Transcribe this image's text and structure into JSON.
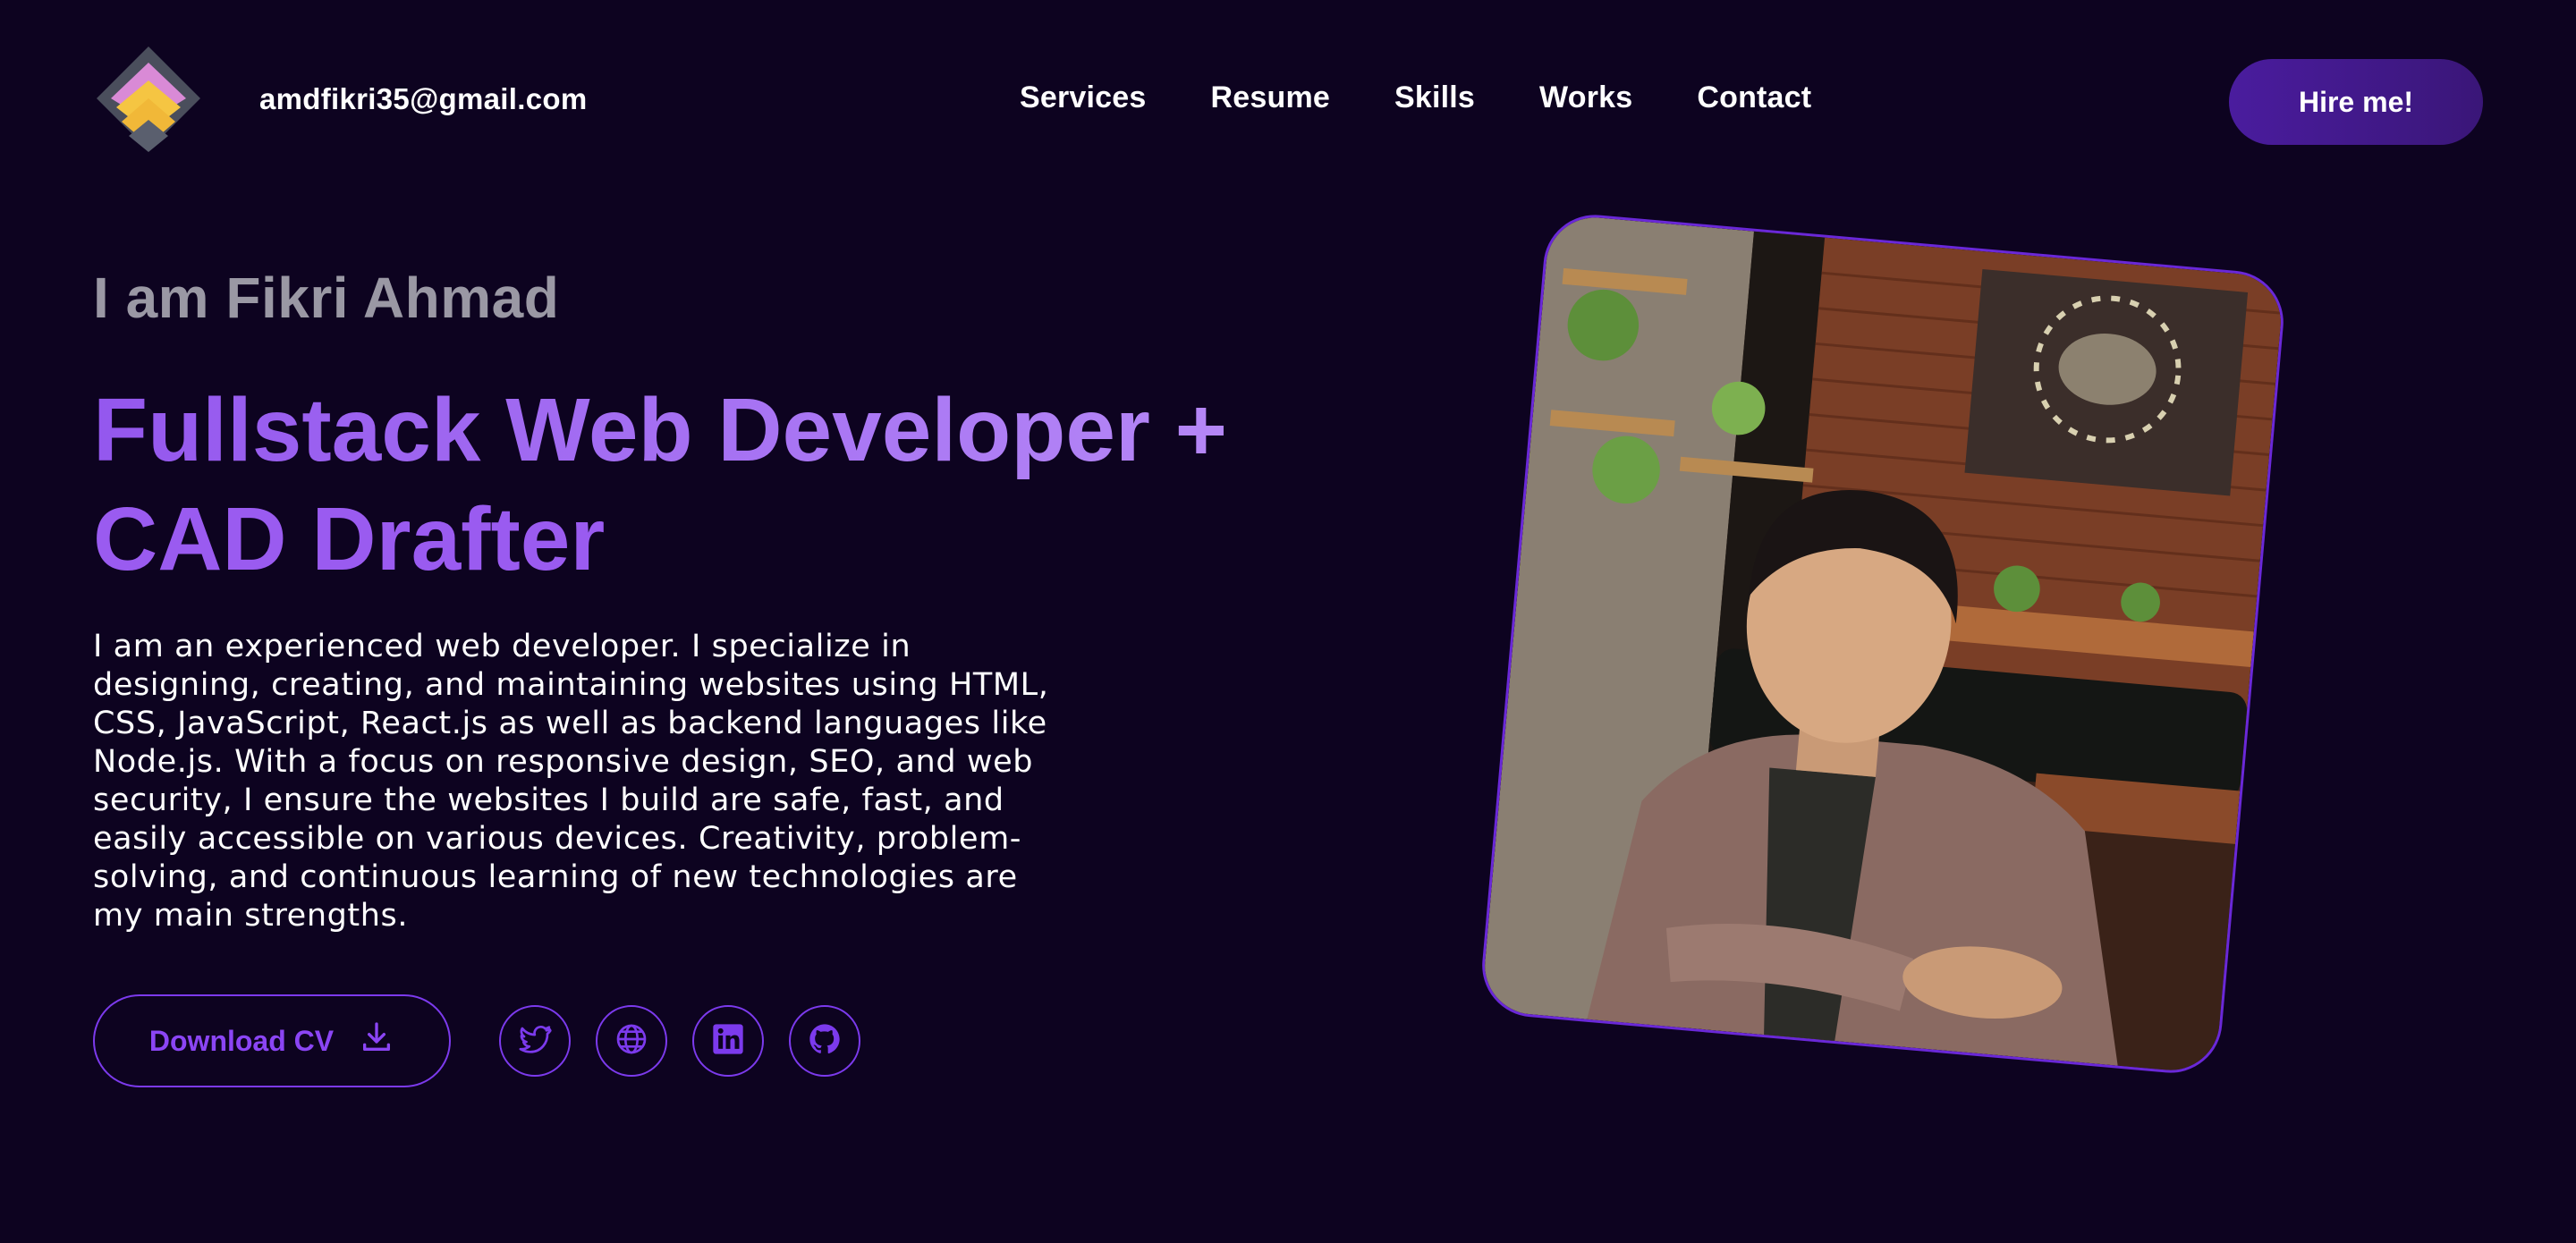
{
  "header": {
    "email": "amdfikri35@gmail.com",
    "nav": [
      {
        "label": "Services"
      },
      {
        "label": "Resume"
      },
      {
        "label": "Skills"
      },
      {
        "label": "Works"
      },
      {
        "label": "Contact"
      }
    ],
    "hire_label": "Hire me!",
    "logo_icon": "diamond-logo-icon"
  },
  "hero": {
    "intro": "I am Fikri Ahmad",
    "headline_line1": "Fullstack Web Developer +",
    "headline_line2": "CAD Drafter",
    "bio": "I am an experienced web developer. I specialize in designing, creating, and maintaining websites using HTML, CSS, JavaScript, React.js as well as backend languages like Node.js. With a focus on responsive design, SEO, and web security, I ensure the websites I build are safe, fast, and easily accessible on various devices. Creativity, problem-solving, and continuous learning of new technologies are my main strengths.",
    "download_cv_label": "Download CV",
    "socials": [
      {
        "icon": "twitter-icon"
      },
      {
        "icon": "globe-icon"
      },
      {
        "icon": "linkedin-icon"
      },
      {
        "icon": "github-icon"
      }
    ]
  },
  "colors": {
    "background": "#0d0320",
    "accent": "#7c3aed",
    "headline": "#a678f0",
    "hire_button": "#4a1c9e",
    "muted_text": "#9a98a4"
  }
}
